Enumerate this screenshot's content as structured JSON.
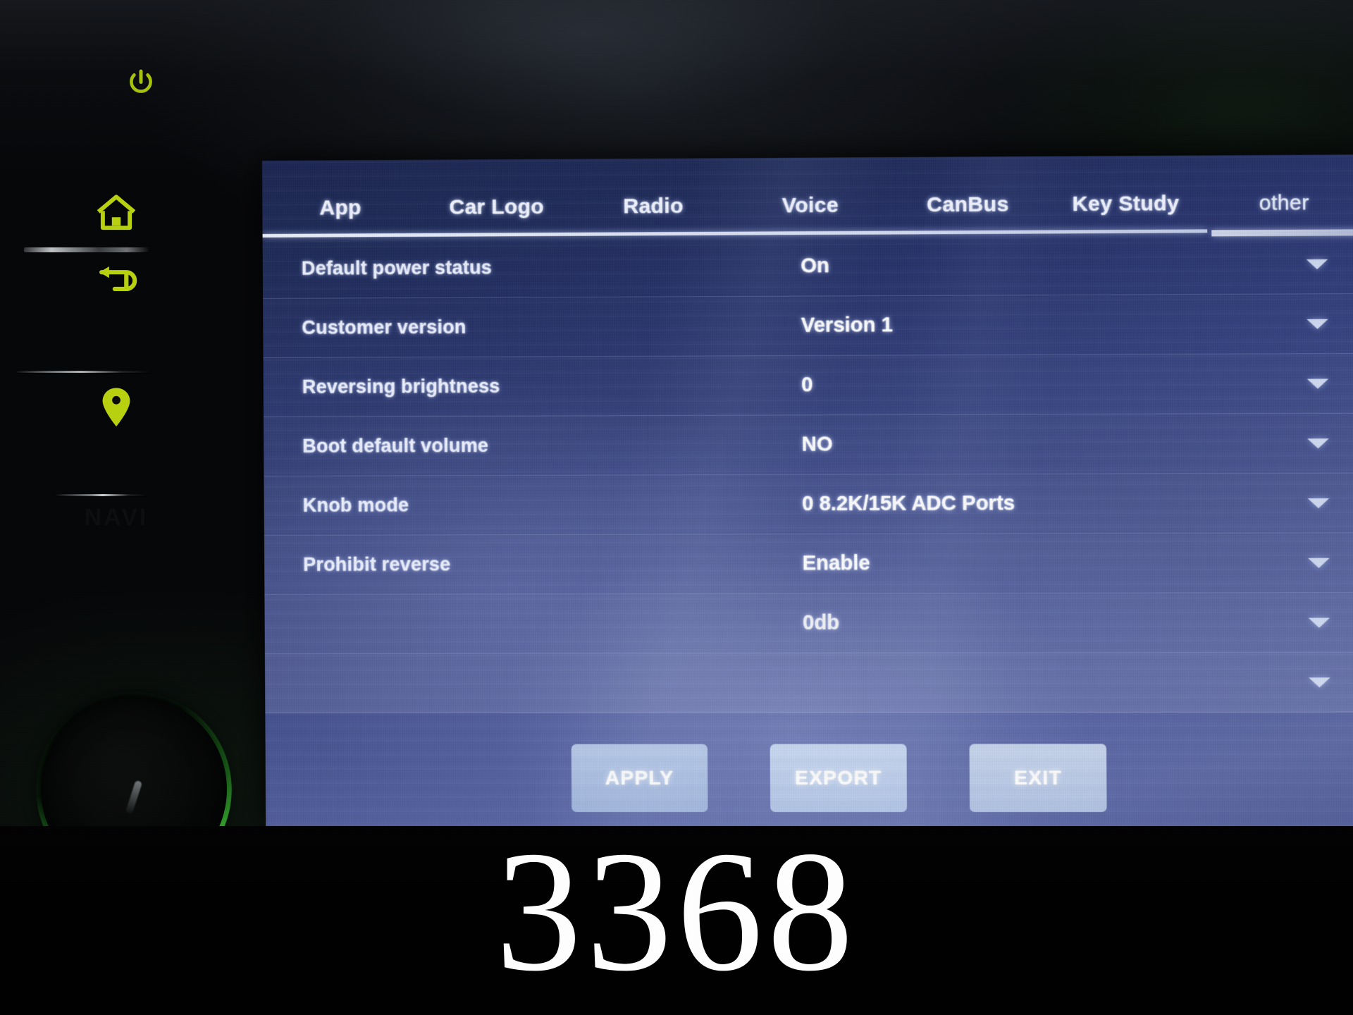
{
  "device": {
    "hardware_buttons": [
      {
        "name": "power-button",
        "icon": "power-icon"
      },
      {
        "name": "home-button",
        "icon": "home-icon"
      },
      {
        "name": "back-button",
        "icon": "back-arrow-icon"
      },
      {
        "name": "navi-button",
        "icon": "location-pin-icon"
      }
    ],
    "navi_label": "NAVI",
    "volume_knob": "volume-knob"
  },
  "screen": {
    "tabs": [
      {
        "label": "App",
        "active": false
      },
      {
        "label": "Car Logo",
        "active": false
      },
      {
        "label": "Radio",
        "active": false
      },
      {
        "label": "Voice",
        "active": false
      },
      {
        "label": "CanBus",
        "active": false
      },
      {
        "label": "Key Study",
        "active": false
      },
      {
        "label": "other",
        "active": true
      }
    ],
    "settings": [
      {
        "label": "Default power status",
        "value": "On",
        "control": "dropdown"
      },
      {
        "label": "Customer version",
        "value": "Version 1",
        "control": "dropdown"
      },
      {
        "label": "Reversing brightness",
        "value": "0",
        "control": "dropdown"
      },
      {
        "label": "Boot default volume",
        "value": "NO",
        "control": "dropdown"
      },
      {
        "label": "Knob mode",
        "value": "0 8.2K/15K ADC Ports",
        "control": "dropdown"
      },
      {
        "label": "Prohibit reverse",
        "value": "Enable",
        "control": "dropdown"
      },
      {
        "label": "",
        "value": "0db",
        "control": "dropdown"
      },
      {
        "label": "",
        "value": "",
        "control": "dropdown"
      }
    ],
    "buttons": [
      {
        "label": "APPLY"
      },
      {
        "label": "EXPORT"
      },
      {
        "label": "EXIT"
      }
    ]
  },
  "overlay": {
    "caption": "3368"
  },
  "colors": {
    "screen_top": "#1b2551",
    "screen_bottom": "#5f6ba6",
    "button_face": "#ccd9f0",
    "icon_green": "#bcd410",
    "knob_green": "#3cd232",
    "text_white": "#ffffff"
  }
}
